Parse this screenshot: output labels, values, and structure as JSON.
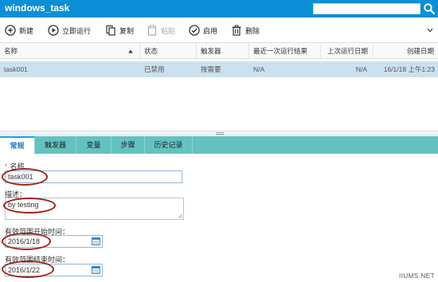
{
  "app": {
    "title": "windows_task"
  },
  "search": {
    "placeholder": ""
  },
  "toolbar": {
    "new_label": "新建",
    "run_label": "立即运行",
    "copy_label": "复制",
    "paste_label": "粘贴",
    "enable_label": "启用",
    "delete_label": "删除"
  },
  "grid": {
    "columns": [
      "名称",
      "状态",
      "触发器",
      "最近一次运行结果",
      "上次运行日期",
      "创建日期"
    ],
    "rows": [
      [
        "task001",
        "已禁用",
        "按需要",
        "N/A",
        "N/A",
        "16/1/18 上午1:23"
      ]
    ]
  },
  "tabs": [
    "常规",
    "触发器",
    "变量",
    "步骤",
    "历史记录"
  ],
  "form": {
    "required_mark": "*",
    "name_label": "名称",
    "name_value": "task001",
    "desc_label": "描述：",
    "desc_value": "by testing",
    "start_label": "有效范围开始时间：",
    "start_value": "2016/1/18",
    "end_label": "有效范围结束时间：",
    "end_value": "2016/1/22"
  },
  "colors": {
    "titlebar": "#0b8fd6",
    "selected_row": "#cbe1ef",
    "tabs_bar": "#63c2c0",
    "annotation": "#a02416"
  },
  "icons": [
    "search-icon",
    "plus-circle-icon",
    "play-circle-icon",
    "copy-icon",
    "paste-icon",
    "check-circle-icon",
    "trash-icon",
    "chevron-down-icon",
    "calendar-icon"
  ],
  "watermark": "IIUMS.NET"
}
